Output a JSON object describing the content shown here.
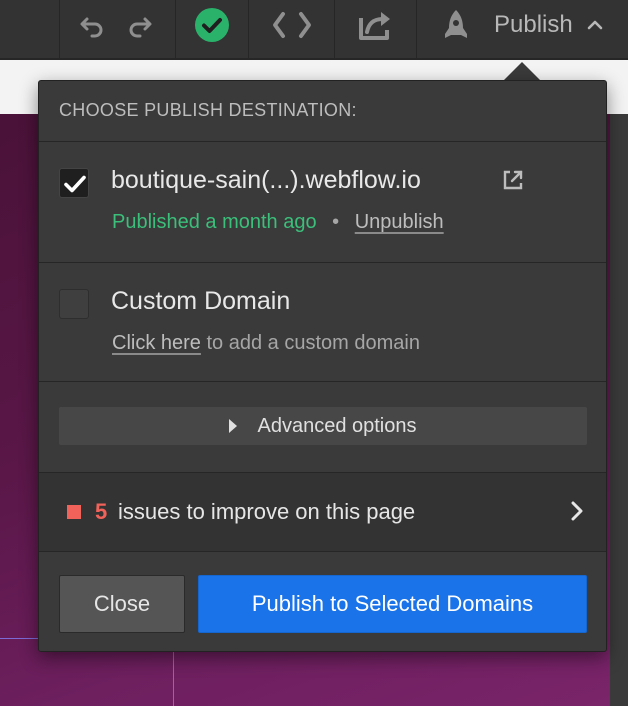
{
  "toolbar": {
    "publish_label": "Publish",
    "icons": [
      "undo-icon",
      "redo-icon",
      "check-circle-icon",
      "code-icon",
      "export-icon",
      "rocket-icon",
      "chevron-up-icon"
    ],
    "status_color": "#2ab26b"
  },
  "popover": {
    "header": "CHOOSE PUBLISH DESTINATION:",
    "webflow": {
      "domain": "boutique-sain(...).webflow.io",
      "checked": true,
      "status": "Published a month ago",
      "separator": "•",
      "unpublish_label": "Unpublish"
    },
    "custom_domain": {
      "title": "Custom Domain",
      "checked": false,
      "link_label": "Click here",
      "link_suffix": " to add a custom domain"
    },
    "advanced_label": "Advanced options",
    "issues": {
      "count": "5",
      "text": "issues to improve on this page"
    },
    "close_label": "Close",
    "publish_label": "Publish to Selected Domains"
  },
  "colors": {
    "accent_blue": "#1a73e8",
    "green": "#3bbf7a",
    "issue_red": "#f0625a"
  }
}
